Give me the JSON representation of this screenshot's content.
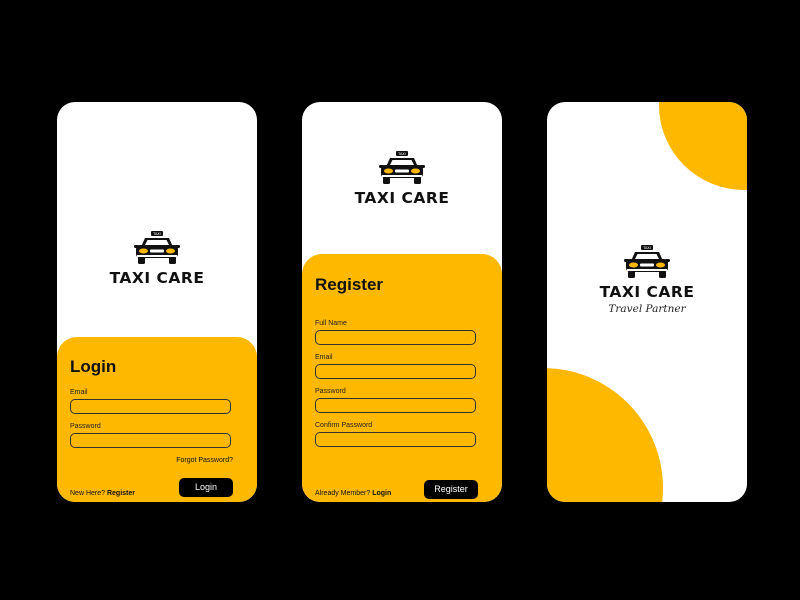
{
  "brand": {
    "name": "TAXI CARE",
    "tagline": "Travel Partner",
    "taxi_sign": "TAXI",
    "accent_color": "#FFB800",
    "icon": "taxi-car-icon"
  },
  "login_screen": {
    "title": "Login",
    "email_label": "Email",
    "email_value": "",
    "password_label": "Password",
    "password_value": "",
    "forgot_password": "Forgot Password?",
    "new_here_prefix": "New Here?",
    "register_link": "Register",
    "login_button": "Login"
  },
  "register_screen": {
    "title": "Register",
    "fullname_label": "Full Name",
    "fullname_value": "",
    "email_label": "Email",
    "email_value": "",
    "password_label": "Password",
    "password_value": "",
    "confirm_label": "Confirm Password",
    "confirm_value": "",
    "already_member_prefix": "Already Member?",
    "login_link": "Login",
    "register_button": "Register"
  }
}
